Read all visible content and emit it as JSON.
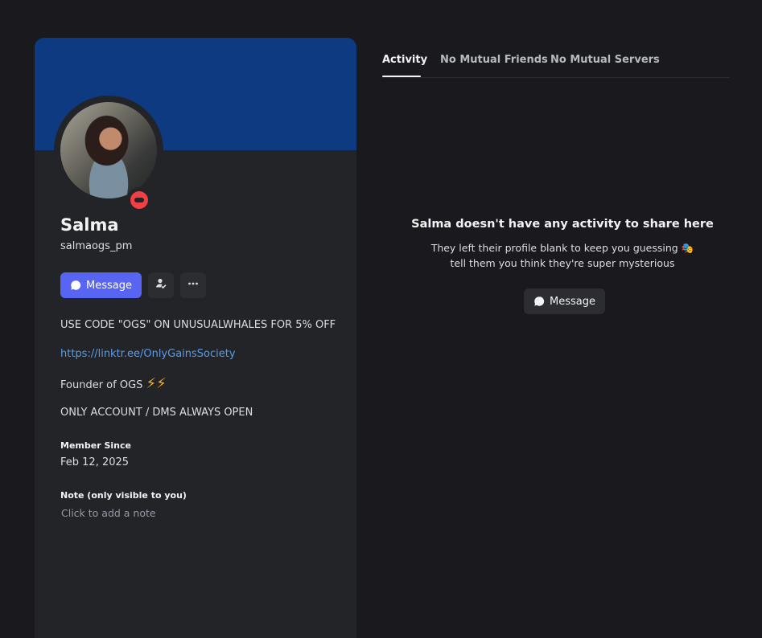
{
  "profile": {
    "display_name": "Salma",
    "username": "salmaogs_pm",
    "status": "do-not-disturb",
    "banner_color": "#0d3a80",
    "actions": {
      "message_label": "Message",
      "friend_icon": "add-friend-icon",
      "more_icon": "more-icon"
    },
    "bio": {
      "line1": "USE CODE \"OGS\" ON UNUSUALWHALES FOR 5% OFF",
      "link": "https://linktr.ee/OnlyGainsSociety",
      "line3": "Founder of OGS",
      "line3_emoji": "⚡⚡",
      "line4": "ONLY ACCOUNT / DMS ALWAYS OPEN"
    },
    "member_since_label": "Member Since",
    "member_since_value": "Feb 12, 2025",
    "note_label": "Note (only visible to you)",
    "note_placeholder": "Click to add a note"
  },
  "tabs": [
    {
      "label": "Activity",
      "active": true
    },
    {
      "label": "No Mutual Friends",
      "active": false
    },
    {
      "label": "No Mutual Servers",
      "active": false
    }
  ],
  "empty_state": {
    "title": "Salma doesn't have any activity to share here",
    "subtitle_line1": "They left their profile blank to keep you guessing",
    "subtitle_emoji": "🎭",
    "subtitle_line2": "tell them you think they're super mysterious",
    "button_label": "Message"
  },
  "colors": {
    "accent": "#5865f2",
    "dnd": "#f23f43",
    "link": "#5b9be6"
  }
}
